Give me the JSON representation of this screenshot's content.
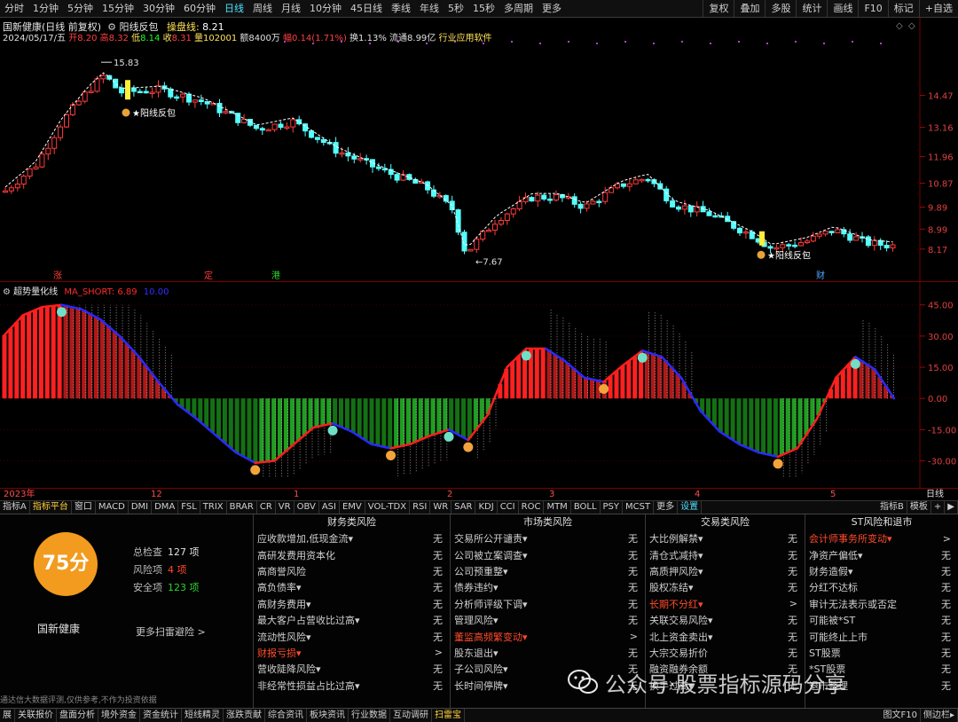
{
  "toolbar": {
    "periods": [
      "分时",
      "1分钟",
      "5分钟",
      "15分钟",
      "30分钟",
      "60分钟",
      "日线",
      "周线",
      "月线",
      "10分钟",
      "45日线",
      "季线",
      "年线",
      "5秒",
      "15秒",
      "多周期",
      "更多"
    ],
    "active_period": "日线",
    "right_buttons": [
      "复权",
      "叠加",
      "多股",
      "统计",
      "画线",
      "F10",
      "标记",
      "+自选"
    ],
    "back_icon": "back-arrow-icon"
  },
  "header": {
    "title": "国新健康(日线 前复权)",
    "indicator_name": "阳线反包",
    "line_label": "操盘线:",
    "line_value": "8.21",
    "date": "2024/05/17/五",
    "open_label": "开",
    "open": "8.20",
    "high_label": "高",
    "high": "8.32",
    "low_label": "低",
    "low": "8.14",
    "close_label": "收",
    "close": "8.31",
    "vol_label": "量",
    "volume": "102001",
    "amount_label": "额",
    "amount": "8400万",
    "change_label": "幅",
    "change": "0.14(1.71%)",
    "turnover": "换1.13%",
    "float_mv": "流通8.99亿",
    "industry": "行业应用软件"
  },
  "price_axis": [
    "14.47",
    "13.16",
    "11.96",
    "10.87",
    "9.89",
    "8.99",
    "8.17"
  ],
  "price_annotations": {
    "high": "15.83",
    "low": "7.67",
    "signal": "阳线反包"
  },
  "event_markers": [
    "涨",
    "定",
    "港",
    "财"
  ],
  "indicator": {
    "name": "超势量化线",
    "ma_label": "MA_SHORT: 6.89",
    "ma_extra": "10.00",
    "axis": [
      "45.00",
      "30.00",
      "15.00",
      "0.00",
      "-15.00",
      "-30.00"
    ]
  },
  "date_axis": {
    "year": "2023年",
    "months": [
      "12",
      "1",
      "2",
      "3",
      "4",
      "5"
    ],
    "right": "日线"
  },
  "tabs": {
    "items": [
      "指标A",
      "指标平台",
      "窗口",
      "MACD",
      "DMI",
      "DMA",
      "FSL",
      "TRIX",
      "BRAR",
      "CR",
      "VR",
      "OBV",
      "ASI",
      "EMV",
      "VOL-TDX",
      "RSI",
      "WR",
      "SAR",
      "KDJ",
      "CCI",
      "ROC",
      "MTM",
      "BOLL",
      "PSY",
      "MCST",
      "更多",
      "设置"
    ],
    "active": "指标平台",
    "right": [
      "指标B",
      "模板",
      "+",
      "▶"
    ]
  },
  "risk": {
    "score": "75分",
    "total_label": "总检查",
    "total": "127 项",
    "risk_label": "风险项",
    "risk_count": "4 项",
    "safe_label": "安全项",
    "safe": "123 项",
    "stock_name": "国新健康",
    "more_scan": "更多扫雷避险 >",
    "disclaimer": "通达信大数据评测,仅供参考,不作为投资依据",
    "columns": [
      {
        "title": "财务类风险",
        "rows": [
          {
            "label": "应收款增加,低现金流▾",
            "value": "无"
          },
          {
            "label": "高研发费用资本化",
            "value": "无"
          },
          {
            "label": "高商誉风险",
            "value": "无"
          },
          {
            "label": "高负债率▾",
            "value": "无"
          },
          {
            "label": "高财务费用▾",
            "value": "无"
          },
          {
            "label": "最大客户占营收比过高▾",
            "value": "无"
          },
          {
            "label": "流动性风险▾",
            "value": "无"
          },
          {
            "label": "财报亏损▾",
            "value": ">",
            "alert": true
          },
          {
            "label": "营收陡降风险▾",
            "value": "无"
          },
          {
            "label": "非经常性损益占比过高▾",
            "value": "无"
          }
        ]
      },
      {
        "title": "市场类风险",
        "rows": [
          {
            "label": "交易所公开谴责▾",
            "value": "无"
          },
          {
            "label": "公司被立案调查▾",
            "value": "无"
          },
          {
            "label": "公司预重整▾",
            "value": "无"
          },
          {
            "label": "债券违约▾",
            "value": "无"
          },
          {
            "label": "分析师评级下调▾",
            "value": "无"
          },
          {
            "label": "管理风险▾",
            "value": "无"
          },
          {
            "label": "董监高频繁变动▾",
            "value": ">",
            "alert": true
          },
          {
            "label": "股东退出▾",
            "value": "无"
          },
          {
            "label": "子公司风险▾",
            "value": "无"
          },
          {
            "label": "长时间停牌▾",
            "value": "无"
          }
        ]
      },
      {
        "title": "交易类风险",
        "rows": [
          {
            "label": "大比例解禁▾",
            "value": "无"
          },
          {
            "label": "清仓式减持▾",
            "value": "无"
          },
          {
            "label": "高质押风险▾",
            "value": "无"
          },
          {
            "label": "股权冻结▾",
            "value": "无"
          },
          {
            "label": "长期不分红▾",
            "value": ">",
            "alert": true
          },
          {
            "label": "关联交易风险▾",
            "value": "无"
          },
          {
            "label": "北上资金卖出▾",
            "value": "无"
          },
          {
            "label": "大宗交易折价",
            "value": "无"
          },
          {
            "label": "融资融券余额",
            "value": "无"
          },
          {
            "label": "换手过高▾",
            "value": "无"
          }
        ]
      },
      {
        "title": "ST风险和退市",
        "rows": [
          {
            "label": "会计师事务所变动▾",
            "value": ">",
            "alert": true
          },
          {
            "label": "净资产偏低▾",
            "value": "无"
          },
          {
            "label": "财务造假▾",
            "value": "无"
          },
          {
            "label": "分红不达标",
            "value": "无"
          },
          {
            "label": "审计无法表示或否定",
            "value": "无"
          },
          {
            "label": "可能被*ST",
            "value": "无"
          },
          {
            "label": "可能终止上市",
            "value": "无"
          },
          {
            "label": "ST股票",
            "value": "无"
          },
          {
            "label": "*ST股票",
            "value": "无"
          },
          {
            "label": "退市整理",
            "value": "无"
          }
        ]
      }
    ]
  },
  "watermark": "公众号·股票指标源码分享",
  "bottom": {
    "items": [
      "展",
      "关联报价",
      "盘面分析",
      "境外资金",
      "资金统计",
      "短线精灵",
      "涨跌贡献",
      "综合资讯",
      "板块资讯",
      "行业数据",
      "互动调研",
      "扫雷宝"
    ],
    "active": "扫雷宝",
    "right": [
      "图文F10",
      "侧边栏▸"
    ]
  },
  "colors": {
    "up": "#ff3c3c",
    "down": "#54ffff",
    "accent_orange": "#f29b1f",
    "ma_red": "#ff1e1e",
    "ma_blue": "#2a2aff",
    "green_bar": "#1f9e1f"
  },
  "chart_data": {
    "type": "candlestick",
    "price_ticks": [
      14.47,
      13.16,
      11.96,
      10.87,
      9.89,
      8.99,
      8.17
    ],
    "high": 15.83,
    "low": 7.67,
    "indicator_ticks": [
      45,
      30,
      15,
      0,
      -15,
      -30
    ],
    "indicator_line": [
      30,
      40,
      44,
      45,
      43,
      38,
      30,
      20,
      8,
      -3,
      -10,
      -18,
      -26,
      -31,
      -30,
      -22,
      -14,
      -12,
      -16,
      -22,
      -24,
      -22,
      -18,
      -15,
      -20,
      -8,
      15,
      24,
      24,
      18,
      10,
      8,
      16,
      23,
      20,
      10,
      -6,
      -16,
      -22,
      -26,
      -28,
      -24,
      -10,
      10,
      20,
      14,
      0
    ]
  }
}
